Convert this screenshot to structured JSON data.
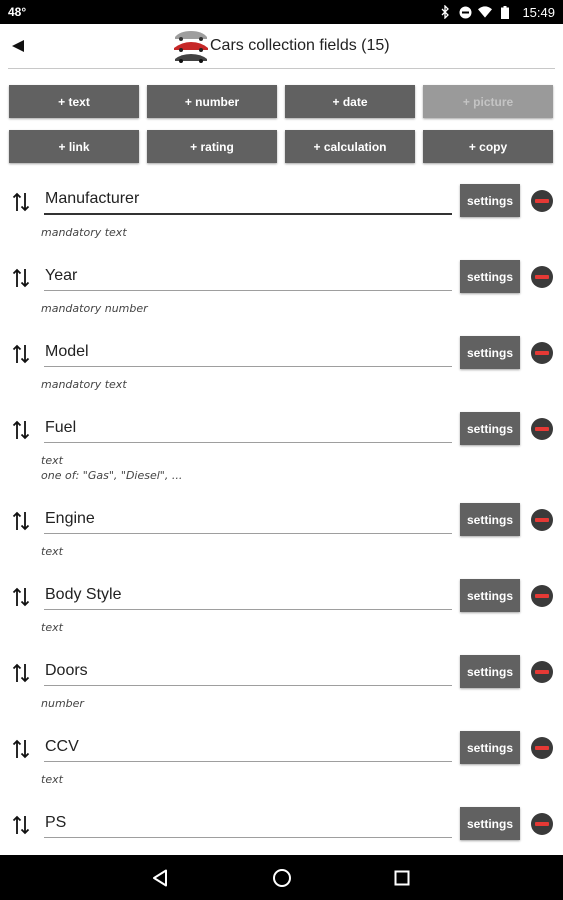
{
  "status_bar": {
    "temperature": "48°",
    "time": "15:49",
    "icons": [
      "bluetooth-icon",
      "do-not-disturb-icon",
      "wifi-icon",
      "battery-icon"
    ]
  },
  "header": {
    "back_icon": "back-arrow-icon",
    "logo_icon": "cars-logo-icon",
    "title": "Cars collection fields (15)"
  },
  "add_buttons": [
    {
      "label": "+ text",
      "enabled": true
    },
    {
      "label": "+ number",
      "enabled": true
    },
    {
      "label": "+ date",
      "enabled": true
    },
    {
      "label": "+ picture",
      "enabled": false
    },
    {
      "label": "+ link",
      "enabled": true
    },
    {
      "label": "+ rating",
      "enabled": true
    },
    {
      "label": "+ calculation",
      "enabled": true
    },
    {
      "label": "+ copy",
      "enabled": true
    }
  ],
  "settings_label": "settings",
  "fields": [
    {
      "name": "Manufacturer",
      "desc": "mandatory text"
    },
    {
      "name": "Year",
      "desc": "mandatory number"
    },
    {
      "name": "Model",
      "desc": "mandatory text"
    },
    {
      "name": "Fuel",
      "desc": "text",
      "desc2": "one of: \"Gas\", \"Diesel\", ..."
    },
    {
      "name": "Engine",
      "desc": "text"
    },
    {
      "name": "Body Style",
      "desc": "text"
    },
    {
      "name": "Doors",
      "desc": "number"
    },
    {
      "name": "CCV",
      "desc": "text"
    },
    {
      "name": "PS",
      "desc": ""
    }
  ],
  "nav_bar": {
    "back": "nav-back-icon",
    "home": "nav-home-icon",
    "recents": "nav-recents-icon"
  },
  "colors": {
    "button_bg": "#616161",
    "button_disabled_bg": "#9a9a9a",
    "remove_red": "#e53935"
  }
}
